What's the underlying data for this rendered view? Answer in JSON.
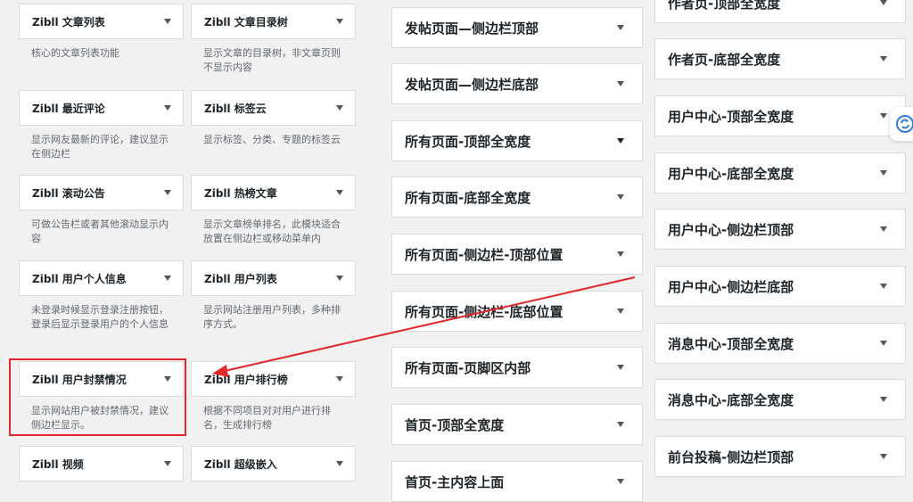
{
  "widgets": [
    {
      "title": "Zibll 文章列表",
      "desc": "核心的文章列表功能"
    },
    {
      "title": "Zibll 文章目录树",
      "desc": "显示文章的目录树，非文章页则不显示内容"
    },
    {
      "title": "Zibll 最近评论",
      "desc": "显示网友最新的评论，建议显示在侧边栏"
    },
    {
      "title": "Zibll 标签云",
      "desc": "显示标签、分类、专题的标签云"
    },
    {
      "title": "Zibll 滚动公告",
      "desc": "可做公告栏或者其他滚动显示内容"
    },
    {
      "title": "Zibll 热榜文章",
      "desc": "显示文章榜单排名，此模块适合放置在侧边栏或移动菜单内"
    },
    {
      "title": "Zibll 用户个人信息",
      "desc": "未登录时候显示登录注册按钮，登录后显示登录用户的个人信息"
    },
    {
      "title": "Zibll 用户列表",
      "desc": "显示网站注册用户列表，多种排序方式。"
    },
    {
      "title": "Zibll 用户封禁情况",
      "desc": "显示网站用户被封禁情况，建议侧边栏显示。"
    },
    {
      "title": "Zibll 用户排行榜",
      "desc": "根据不同项目对对用户进行排名，生成排行榜"
    },
    {
      "title": "Zibll 视频",
      "desc": ""
    },
    {
      "title": "Zibll 超级嵌入",
      "desc": ""
    }
  ],
  "sidebars_middle": [
    "发帖页面—侧边栏顶部",
    "发帖页面—侧边栏底部",
    "所有页面-顶部全宽度",
    "所有页面-底部全宽度",
    "所有页面-侧边栏-顶部位置",
    "所有页面-侧边栏-底部位置",
    "所有页面-页脚区内部",
    "首页-顶部全宽度",
    "首页-主内容上面"
  ],
  "sidebars_right": [
    "作者页-顶部全宽度",
    "作者页-底部全宽度",
    "用户中心-顶部全宽度",
    "用户中心-底部全宽度",
    "用户中心-侧边栏顶部",
    "用户中心-侧边栏底部",
    "消息中心-顶部全宽度",
    "消息中心-底部全宽度",
    "前台投稿-侧边栏顶部"
  ],
  "colors": {
    "annotation": "#e0282d",
    "float_icon": "#2f7dd8"
  },
  "icons": {
    "float_button": "sync-icon"
  }
}
